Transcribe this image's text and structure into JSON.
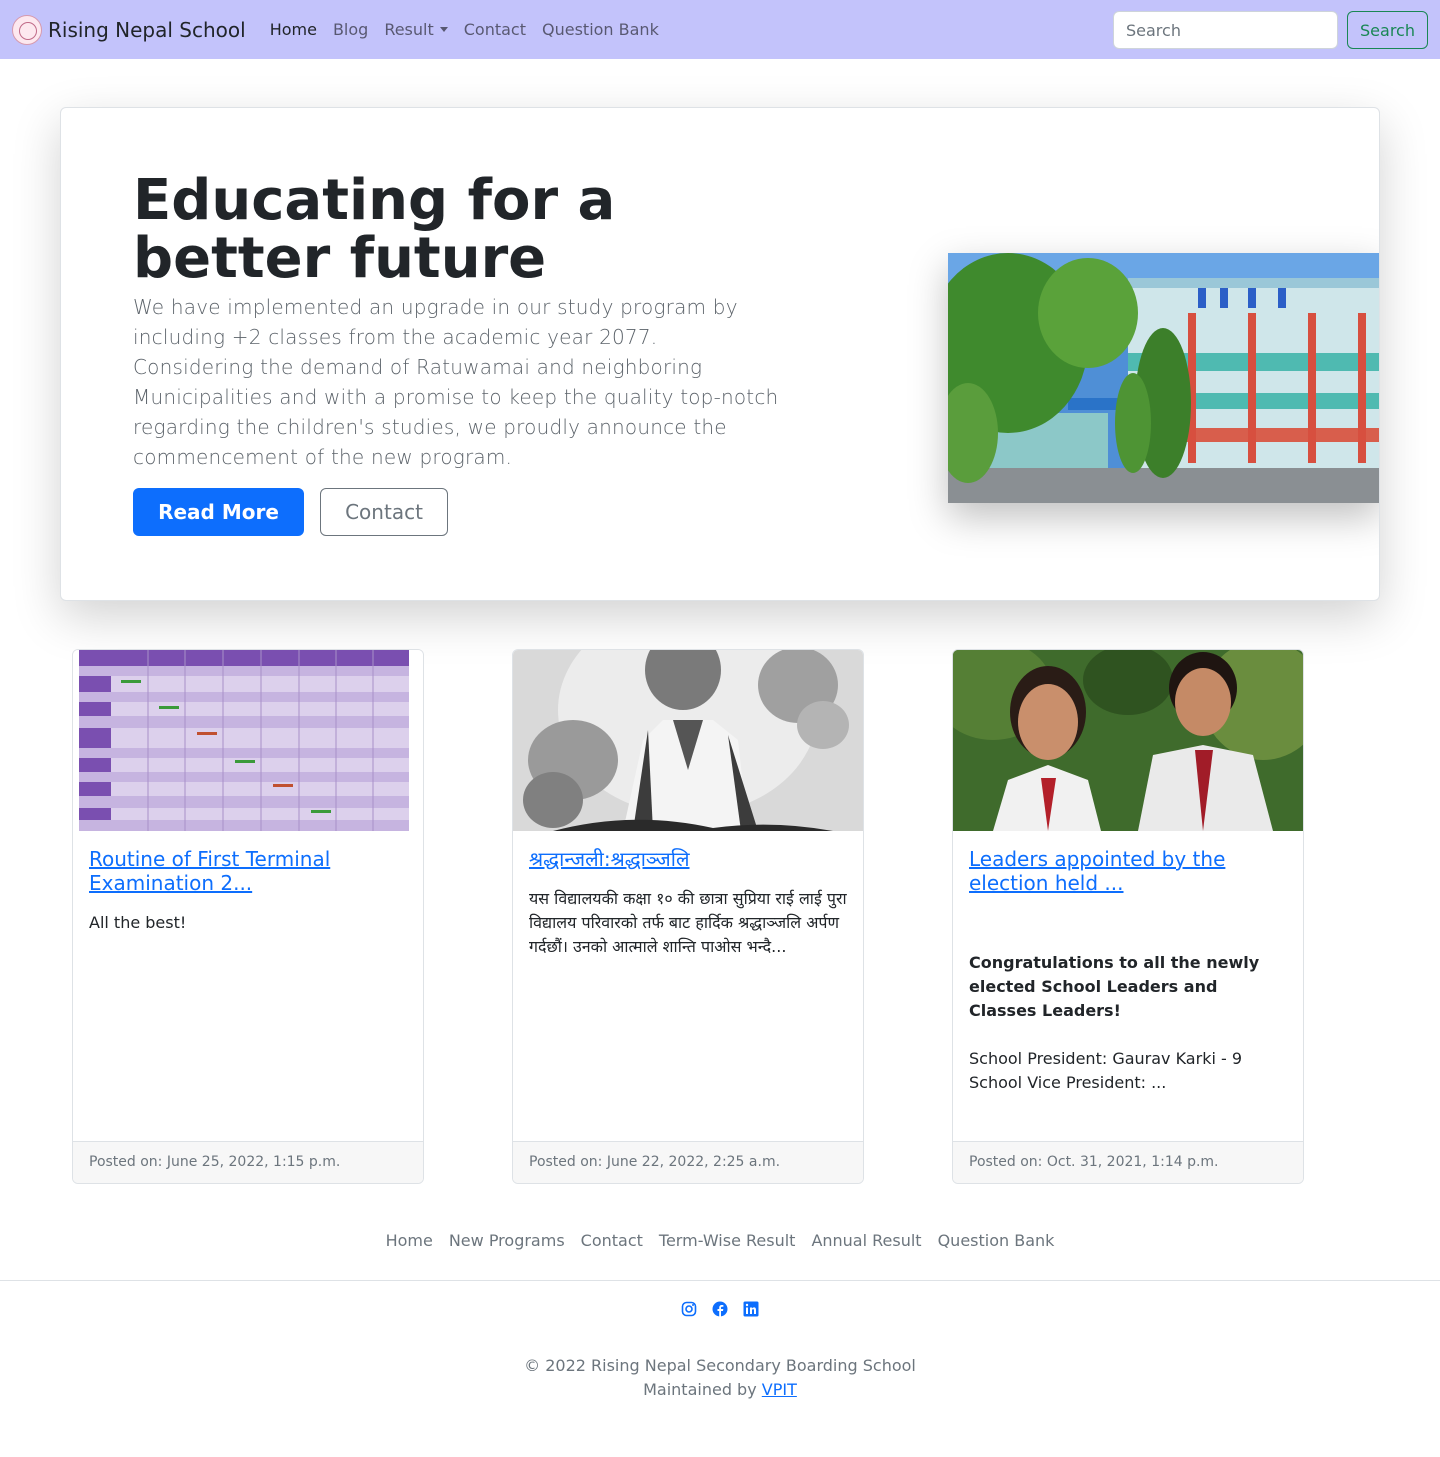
{
  "navbar": {
    "brand": "Rising Nepal School",
    "links": [
      "Home",
      "Blog",
      "Result",
      "Contact",
      "Question Bank"
    ],
    "search_placeholder": "Search",
    "search_button": "Search"
  },
  "hero": {
    "title": "Educating for a better future",
    "lead": "We have implemented an upgrade in our study program by including +2 classes from the academic year 2077. Considering the demand of Ratuwamai and neighboring Municipalities and with a promise to keep the quality top-notch regarding the children's studies, we proudly announce the commencement of the new program.",
    "read_more": "Read More",
    "contact": "Contact"
  },
  "posts": [
    {
      "title": "Routine of First Terminal Examination 2...",
      "excerpt": "All the best!",
      "footer": "Posted on: June 25, 2022, 1:15 p.m."
    },
    {
      "title": "श्रद्धान्जली:श्रद्धाञ्जलि",
      "excerpt": "यस विद्यालयकी कक्षा १० की छात्रा सुप्रिया राई लाई पुरा विद्यालय परिवारको तर्फ बाट हार्दिक श्रद्धाञ्जलि अर्पण गर्दछौं। उनको आत्माले शान्ति पाओस भन्दै...",
      "footer": "Posted on: June 22, 2022, 2:25 a.m."
    },
    {
      "title": "Leaders appointed by the election held ...",
      "excerpt_bold": "Congratulations to all the newly elected School Leaders and Classes Leaders!",
      "excerpt_line1": "School President: Gaurav Karki - 9",
      "excerpt_line2": "School Vice President: ...",
      "footer": "Posted on: Oct. 31, 2021, 1:14 p.m."
    }
  ],
  "footer": {
    "links": [
      "Home",
      "New Programs",
      "Contact",
      "Term-Wise Result",
      "Annual Result",
      "Question Bank"
    ],
    "social_icons": [
      "instagram-icon",
      "facebook-icon",
      "linkedin-icon"
    ],
    "copyright": "© 2022 Rising Nepal Secondary Boarding School",
    "maintained_prefix": "Maintained by",
    "maintained_link": "VPIT"
  },
  "colors": {
    "navbar_bg": "#c3c3fb",
    "primary": "#0d6efd",
    "success": "#198754",
    "muted": "#6c757d"
  }
}
